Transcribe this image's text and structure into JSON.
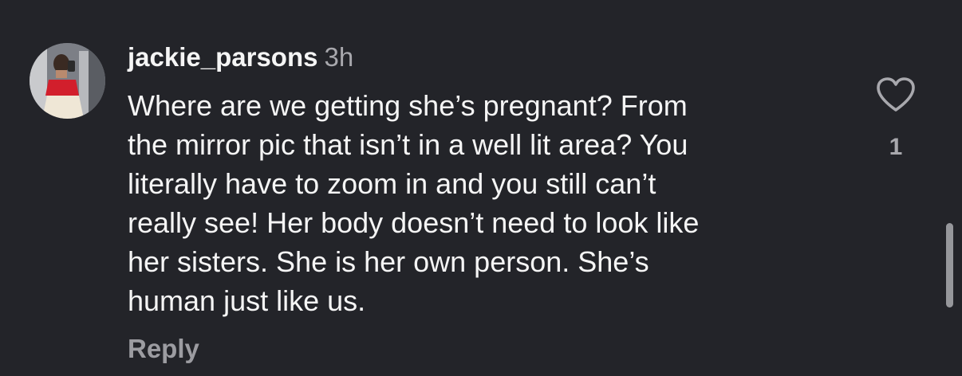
{
  "comment": {
    "username": "jackie_parsons",
    "timestamp": "3h",
    "text_lines": [
      "Where are we getting she’s pregnant? From",
      "the mirror pic that isn’t in a well lit area? You",
      "literally have to zoom in and you still can’t",
      "really see! Her body doesn’t need to look like",
      "her sisters. She is her own person. She’s",
      "human just like us."
    ],
    "reply_label": "Reply",
    "like_count": "1",
    "like_icon": "heart-outline-icon"
  },
  "colors": {
    "background": "#232429",
    "text": "#f5f5f5",
    "muted": "#a8a8ad",
    "reply": "#9c9ca1"
  }
}
